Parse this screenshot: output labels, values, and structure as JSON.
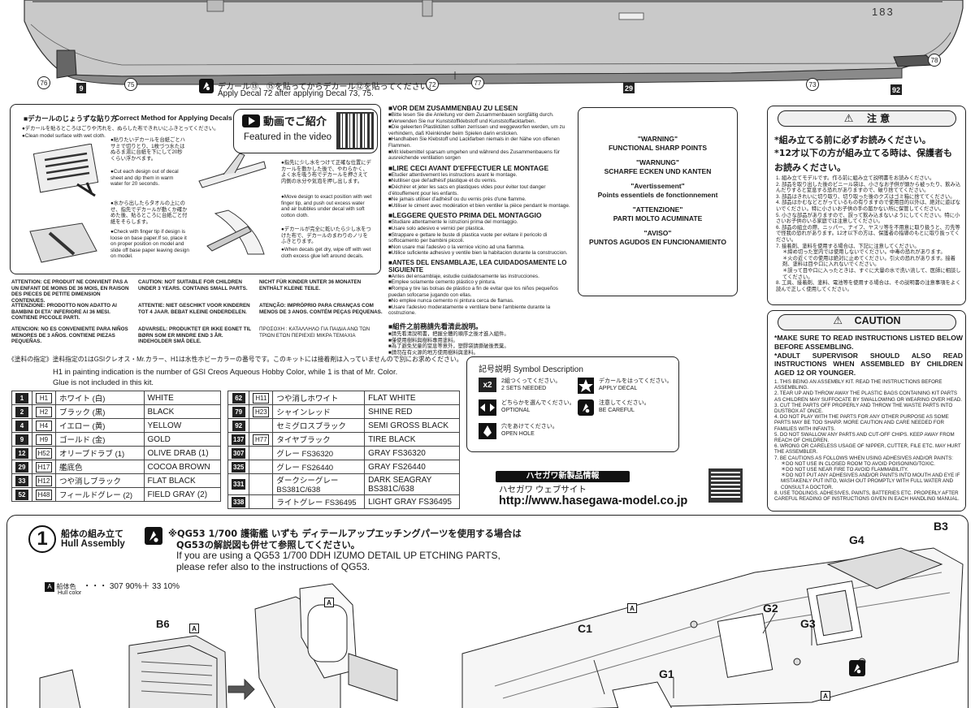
{
  "hull_top": {
    "hull_number": "183",
    "decal_note_jp": "デカール⑬、⑮を貼ってからデカール⑫を貼ってください。",
    "decal_note_en": "Apply Decal 72 after applying Decal 73, 75.",
    "callouts": [
      "76",
      "75",
      "72",
      "77",
      "73",
      "78"
    ],
    "square_labels": [
      "9",
      "29",
      "92"
    ]
  },
  "decal_box": {
    "title_jp": "■デカールのじょうずな貼り方",
    "title_en": "Correct Method for Applying Decals",
    "video_jp": "動画でご紹介",
    "video_en": "Featured in the video",
    "step1_jp": "●デカールを貼るところはごりや汚れを、ぬらした布できれいにふきとってください。",
    "step1_en": "●Clean model surface with wet cloth.",
    "step2_jp": "●貼りたいデカールを台紙ごとハサミで切りとり、1枚づつ水たはぬるま湯に台紙を下にして20秒くらい浮かべます。",
    "step2_en": "●Cut each design out of decal sheet and dip them in warm water for 20 seconds.",
    "step3_jp": "●水から出したらタオルの上にのせ、指先でデカールが動くか確かめた後、貼るところに台紙ごと付紙をそらします。",
    "step3_en": "●Check with finger tip if design is loose on base paper.If so, place it on proper position on model and slide off base paper leaving design on model.",
    "step4_jp": "●指先に少し水をつけて正確な位置にデカールを動かした後で、やわらかく、よく水を吸う布でデカールを押さえて内側の水分や気泡を押し出します。",
    "step4_en": "●Move design to exact position with wet finger tip, and push out excess water and air bubbles under decal with soft cotton cloth.",
    "step5_jp": "●デカールが完全に乾いたら少し水をつけた布で、デカールのまわりのノリをふきとります。",
    "step5_en": "●When decals get dry, wipe off with wet cloth excess glue left around decals."
  },
  "assembly_notes": [
    {
      "title": "■VOR DEM ZUSAMMENBAU ZU LESEN",
      "lines": [
        "■Bitte lesen Sie die Anleitung vor dem Zusammenbauen sorgfältig durch.",
        "■Verwenden Sie nur Kunststoffklebstoff und Kunststoffacktarben.",
        "■Die geleerten Plastiktüten sollten zerrissen und weggeworfen werden, um zu verhindern, daß Kleinkinder beim Spielen darin ersticken.",
        "■Handhaben Sie Klebstoff und Lackfarben niemals in der Nähe von offenen Flammen.",
        "■Mit klebemittel sparsam umgehen und während des Zusammenbauens für ausreichende ventilation sorgen"
      ]
    },
    {
      "title": "■LIRE CECI AVANT D'EFFECTUER LE MONTAGE",
      "lines": [
        "■Etudier attentivement les instructions avant le montage.",
        "■Nutiliser que del'adhésif plastique et du vernis.",
        "■Déchirer et jeter les sacs en plastiques vides pour éviter tout danger d'étouffement pour les enfants.",
        "■Ne jamais utiliser d'adhésif ou du vernis près d'une flamme.",
        "■Utiliser le ciment avec modération et bien ventiler la pièce pendant le montage."
      ]
    },
    {
      "title": "■LEGGERE QUESTO PRIMA DEL MONTAGGIO",
      "lines": [
        "■Studiare attentamente le istruzioni prima del montaggio.",
        "■Usare solo adesivo e vernici per plastica.",
        "■Strappare e gettare le buste di plastica vuote per evitare il pericolo di soffocamento per bambini piccoli.",
        "■Non usare mai l'adesivo o la vernice vicino ad una fiamma.",
        "■Utilice suficiente adhesivo y ventile bien la habitacion durante la construccion."
      ]
    },
    {
      "title": "■ANTES DEL ENSAMBLAJE, LEA CUIDADOSAMENTE LO SIGUIENTE",
      "lines": [
        "■Antes del ensamblaje, estudie cuidadosamente las instrucciones.",
        "■Emplee solamente cemento plástico y pintura.",
        "■Rompa y tire las bolsas de plástico a fin de evitar que los niños pequeños puedan sofocarse jugando con ellas.",
        "■No emplee nunca cemento ni pintura cerca de flamas.",
        "■Usare l'adesivo moderatamente e ventilare bene l'ambiente durante la costruzione."
      ]
    },
    {
      "title": "■組件之前務請先看清此說明。",
      "lines": [
        "■請先看清說明書，把握全體的順序之後才進入組件。",
        "■僅使用樹料與樹料專用塗料。",
        "■為了避免兒童的窒息等意外，塑膠袋請撕破後丟棄。",
        "■請勿在有火源的地方使用樹料與塗料。"
      ]
    }
  ],
  "warnings": [
    {
      "title": "\"WARNING\"",
      "body": "FUNCTIONAL SHARP POINTS"
    },
    {
      "title": "\"WARNUNG\"",
      "body": "SCHARFE ECKEN UND KANTEN"
    },
    {
      "title": "\"Avertissement\"",
      "body": "Points essentiels de fonctionnement"
    },
    {
      "title": "\"ATTENZIONE\"",
      "body": "PARTI MOLTO ACUMINATE"
    },
    {
      "title": "\"AVISO\"",
      "body": "PUNTOS AGUDOS EN FUNCIONAMIENTO"
    }
  ],
  "small_parts": [
    "ATTENTION: CE PRODUIT NE CONVIENT PAS A UN ENFANT DE MOINS DE 36 MOIS, EN RAISON DES PIECES DE PETITE DIMENSION CONTENUES.",
    "CAUTION: NOT SUITABLE FOR CHILDREN UNDER 3 YEARS. CONTAINS SMALL PARTS.",
    "NICHT FÜR KINDER UNTER 36 MONATEN ENTHÄLT KLEINE TEILE.",
    "ATTENZIONE: PRODOTTO NON ADATTO AI BAMBINI DI ETA' INFERIORE AI 36 MESI. CONTIENE PICCOLE PARTI.",
    "ATTENTIE: NIET GESCHIKT VOOR KINDEREN TOT 4 JAAR. BEBAT KLEINE ONDERDELEN.",
    "ATENÇÃO: IMPRÓPRIO PARA CRIANÇAS COM MENOS DE 3 ANOS. CONTÉM PEÇAS PEQUENAS.",
    "ATENCION: NO ES CONVENIENTE PARA NIÑOS MENORES DE 3 AÑOS. CONTIENE PIEZAS PEQUEÑAS.",
    "ADVARSEL: PRODUKTET ER IKKE EGNET TIL BØRN SOM ER MINDRE END 3 ÅR. INDEHOLDER SMÅ DELE.",
    "ΠΡΟΣΟΧΗ : ΚΑΤΑΛΛΗΛΟ ΓΙΑ ΠΑΙΔΙΑ ΑΝΩ ΤΩΝ ΤΡΙΩΝ ΕΤΩΝ ΠΕΡΙΕΧΕΙ ΜΙΚΡΑ ΤΕΜΑΧΙΑ"
  ],
  "paint": {
    "header_jp": "《塗料の指定》塗料指定の1はGSIクレオス・Mr.カラー、H1は水性ホビーカラーの番号です。このキットには接着剤は入っていませんので別にお求めください。",
    "header_en1": "H1 in painting indication is the number of GSI Creos Aqueous Hobby Color, while 1 is that of Mr. Color.",
    "header_en2": "Glue is not included in this kit.",
    "left": [
      {
        "mr": "1",
        "h": "H1",
        "jp": "ホワイト (白)",
        "en": "WHITE"
      },
      {
        "mr": "2",
        "h": "H2",
        "jp": "ブラック (黒)",
        "en": "BLACK"
      },
      {
        "mr": "4",
        "h": "H4",
        "jp": "イエロー (黄)",
        "en": "YELLOW"
      },
      {
        "mr": "9",
        "h": "H9",
        "jp": "ゴールド (金)",
        "en": "GOLD"
      },
      {
        "mr": "12",
        "h": "H52",
        "jp": "オリーブドラブ (1)",
        "en": "OLIVE DRAB (1)"
      },
      {
        "mr": "29",
        "h": "H17",
        "jp": "艦底色",
        "en": "COCOA BROWN"
      },
      {
        "mr": "33",
        "h": "H12",
        "jp": "つや消しブラック",
        "en": "FLAT BLACK"
      },
      {
        "mr": "52",
        "h": "H48",
        "jp": "フィールドグレー (2)",
        "en": "FIELD GRAY (2)"
      }
    ],
    "right": [
      {
        "mr": "62",
        "h": "H11",
        "jp": "つや消しホワイト",
        "en": "FLAT WHITE"
      },
      {
        "mr": "79",
        "h": "H23",
        "jp": "シャインレッド",
        "en": "SHINE RED"
      },
      {
        "mr": "92",
        "h": "",
        "jp": "セミグロスブラック",
        "en": "SEMI GROSS BLACK"
      },
      {
        "mr": "137",
        "h": "H77",
        "jp": "タイヤブラック",
        "en": "TIRE BLACK"
      },
      {
        "mr": "307",
        "h": "",
        "jp": "グレー FS36320",
        "en": "GRAY FS36320"
      },
      {
        "mr": "325",
        "h": "",
        "jp": "グレー FS26440",
        "en": "GRAY FS26440"
      },
      {
        "mr": "331",
        "h": "",
        "jp": "ダークシーグレー BS381C/638",
        "en": "DARK SEAGRAY BS381C/638"
      },
      {
        "mr": "338",
        "h": "",
        "jp": "ライトグレー FS36495",
        "en": "LIGHT GRAY FS36495"
      }
    ]
  },
  "symbols": {
    "title": "記号説明  Symbol Description",
    "items": [
      {
        "jp": "2組つくってください。",
        "en": "2 SETS NEEDED"
      },
      {
        "jp": "デカールをはってください。",
        "en": "APPLY DECAL"
      },
      {
        "jp": "どちらかを選んでください。",
        "en": "OPTIONAL"
      },
      {
        "jp": "注意してください。",
        "en": "BE CAREFUL"
      },
      {
        "jp": "穴をあけてください。",
        "en": "OPEN HOLE"
      }
    ],
    "x2": "x2"
  },
  "hasegawa": {
    "banner": "ハセガワ新製品情報",
    "site_jp": "ハセガワ ウェブサイト",
    "url": "http://www.hasegawa-model.co.jp"
  },
  "chui": {
    "title": "注 意",
    "lead1": "*組み立てる前に必ずお読みください。",
    "lead2": "*12才以下の方が組み立てる時は、保護者もお読みください。",
    "items": [
      "1. 組み立てモデルです。作る前に組み立て説明書をお読みください。",
      "2. 部品を取り出した後のビニール袋は、小さなお子供が頭から被ったり、飲み込んだりすると窒息する恐れがありますので、破り捨ててください。",
      "3. 部品はきれいに切り取り、切り取った後のクズはゴミ箱に捨ててください。",
      "4. 部品はかむなどとがっているもの有りますので使用目的以外は、絶対に遊ばないでください。特に小さいお子供の手の届かない所に保管してください。",
      "5. 小さな部品がありますので、誤って飲み込まないようにしてください。特に小さいお子供のいる家庭では注意してください。",
      "6. 部品の組立の際、ニッパー、ナイフ、ヤスリ等を不用意に取り扱うと、刃先等で怪我の恐れがあります。12才以下の方は、保護者の指導のもとに取り扱ってください。",
      "7. 接着剤、塗料を使用する場合は、下記に注意してください。",
      "＊締め切った室内では使用しないでください。中毒の恐れがあります。",
      "＊火の近くでの使用は絶対に止めてください。引火の恐れがあります。接着剤、塗料は目や口に入れないでください。",
      "＊誤って目や口に入ったときは、すぐに大量の水で洗い流して、医師に相談してください。",
      "8. 工具、接着剤、塗料、電池等を使用する場合は、その説明書の注意事項をよく読んで正しく使用してください。"
    ]
  },
  "caution": {
    "title": "CAUTION",
    "lead": "*MAKE SURE TO READ INSTRUCTIONS LISTED BELOW BEFORE ASSEMBLING.\n*ADULT SUPERVISOR SHOULD ALSO READ INSTRUCTIONS WHEN ASSEMBLED BY CHILDREN AGED 12 OR YOUNGER.",
    "items": [
      "1. THIS BEING AN ASSEMBLY KIT. READ THE INSTRUCTIONS BEFORE ASSEMBLING.",
      "2. TEAR UP AND THROW AWAY THE PLASTIC BAGS CONTAINING KIT PARTS AS CHILDREN MAY SUFFOCATE BY SWALLOWING OR WEARING OVER HEAD.",
      "3. CUT THE PARTS OFF PROPERLY AND THROW THE WASTE PARTS INTO DUSTBOX AT ONCE.",
      "4. DO NOT PLAY WITH THE PARTS FOR ANY OTHER PURPOSE AS SOME PARTS MAY BE TOO SHARP. MORE CAUTION AND CARE NEEDED FOR FAMILIES WITH INFANTS.",
      "5. DO NOT SWALLOW ANY PARTS AND CUT-OFF CHIPS. KEEP AWAY FROM REACH OF CHILDREN.",
      "6. WRONG OR CARELESS USAGE OF NIPPER, CUTTER, FILE ETC. MAY HURT THE ASSEMBLER.",
      "7. BE CAUTIONS AS FOLLOWS WHEN USING ADHESIVES AND/OR PAINTS:",
      "＊DO NOT USE IN CLOSED ROOM TO AVOID POISONING/TOXIC.",
      "＊DO NOT USE NEAR FIRE TO AVOID FLAMMABILITY.",
      "＊DO NOT PUT ANY ADHESIVES AND/OR PAINTS INTO MOUTH AND EYE IF MISTAKENLY PUT INTO, WASH OUT PROMPTLY WITH FULL WATER AND CONSULT A DOCTOR.",
      "8. USE TOOLINGS, ADHESIVES, PAINTS, BATTERIES ETC. PROPERLY AFTER CAREFUL READING OF INSTRUCTIONS GIVEN IN EACH HANDLING MANUAL."
    ]
  },
  "step1": {
    "number": "1",
    "title_jp": "船体の組み立て",
    "title_en": "Hull Assembly",
    "note_jp1": "※QG53 1/700 護衛艦 いずも ディテールアップエッチングパーツを使用する場合は",
    "note_jp2": "QG53の解説図も併せて参照してください。",
    "note_en1": "If you are using a QG53 1/700 DDH IZUMO DETAIL UP ETCHING PARTS,",
    "note_en2": "please refer also to the instructions of QG53.",
    "hull_color_label": "船体色",
    "hull_color_en": "Hull color",
    "hull_color_mix": "・・・ 307 90%＋ 33 10%",
    "part_labels": [
      "B6",
      "A",
      "A",
      "G4",
      "B3",
      "G2",
      "G3",
      "C1",
      "G1",
      "A",
      "A"
    ]
  }
}
